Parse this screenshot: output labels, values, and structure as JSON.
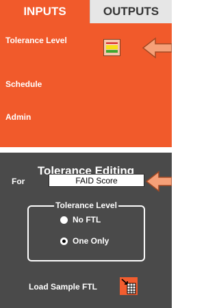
{
  "tabs": {
    "inputs": "INPUTS",
    "outputs": "OUTPUTS"
  },
  "sidebar": {
    "tolerance_level": "Tolerance Level",
    "schedule": "Schedule",
    "admin": "Admin"
  },
  "editor": {
    "title": "Tolerance Editing",
    "for_label": "For",
    "for_value": "FAID Score",
    "group_title": "Tolerance Level",
    "options": [
      "No FTL",
      "One Only"
    ],
    "selected_option": "One Only",
    "load_sample_label": "Load Sample FTL"
  },
  "colors": {
    "accent": "#f15a2b",
    "panel_dark": "#4a4a4a",
    "tab_inactive": "#e6e6e6"
  },
  "icons": {
    "tolerance": "tolerance-level-icon",
    "load": "grid-table-icon",
    "pointer": "arrow-left-icon"
  }
}
